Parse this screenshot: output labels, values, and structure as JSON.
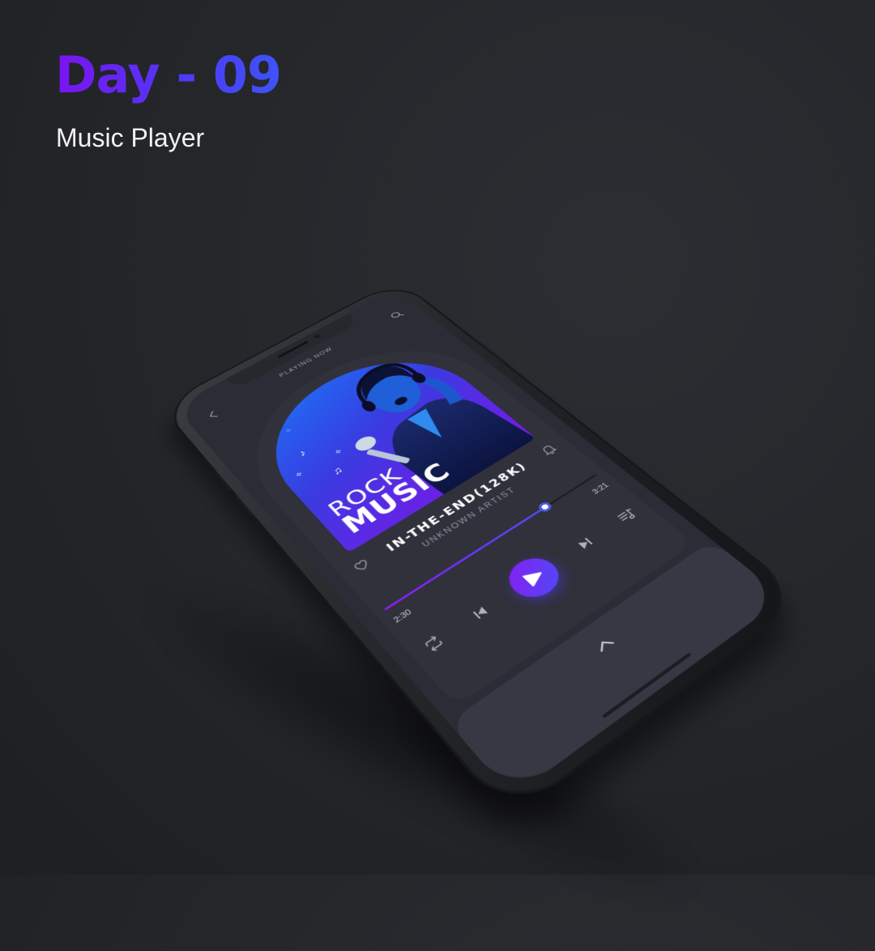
{
  "header": {
    "day_label": "Day - 09",
    "subtitle": "Music Player"
  },
  "app": {
    "top_label": "PLAYING NOW",
    "album_cover": {
      "line1": "ROCK",
      "line2": "MUSIC"
    },
    "track": {
      "title": "IN-THE-END(128K)",
      "artist": "UNKNOWN ARTIST",
      "elapsed": "2:30",
      "duration": "3:21",
      "progress": 0.747
    },
    "icons": {
      "back": "chevron-left-icon",
      "search": "search-icon",
      "favorite": "heart-icon",
      "notify": "bell-icon",
      "repeat": "repeat-icon",
      "previous": "skip-previous-icon",
      "play": "play-icon",
      "next": "skip-next-icon",
      "playlist": "playlist-icon",
      "expand": "chevron-up-icon"
    },
    "colors": {
      "accent_start": "#8a1cf0",
      "accent_end": "#4b4df7",
      "background": "#2b2c35"
    }
  }
}
